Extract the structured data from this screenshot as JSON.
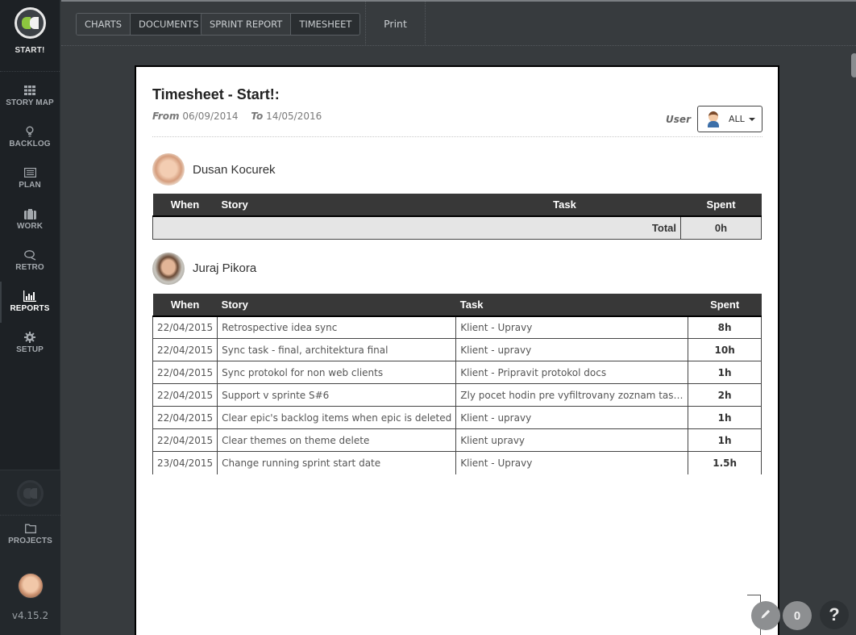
{
  "sidebar": {
    "brand": "START!",
    "items": [
      {
        "label": "STORY MAP",
        "icon": "grid-icon",
        "active": false
      },
      {
        "label": "BACKLOG",
        "icon": "lightbulb-icon",
        "active": false
      },
      {
        "label": "PLAN",
        "icon": "list-icon",
        "active": false
      },
      {
        "label": "WORK",
        "icon": "briefcase-icon",
        "active": false
      },
      {
        "label": "RETRO",
        "icon": "chat-icon",
        "active": false
      },
      {
        "label": "REPORTS",
        "icon": "bar-chart-icon",
        "active": true
      },
      {
        "label": "SETUP",
        "icon": "gear-icon",
        "active": false
      }
    ],
    "projects_label": "PROJECTS",
    "version": "v4.15.2"
  },
  "toolbar": {
    "group1": [
      {
        "label": "CHARTS",
        "active": false
      },
      {
        "label": "DOCUMENTS",
        "active": true
      }
    ],
    "group2": [
      {
        "label": "SPRINT REPORT",
        "active": false
      },
      {
        "label": "TIMESHEET",
        "active": true
      }
    ],
    "print_label": "Print"
  },
  "report": {
    "title": "Timesheet - Start!:",
    "from_label": "From",
    "from_date": "06/09/2014",
    "to_label": "To",
    "to_date": "14/05/2016",
    "user_label": "User",
    "user_value": "ALL"
  },
  "columns": {
    "when": "When",
    "story": "Story",
    "task": "Task",
    "spent": "Spent"
  },
  "people": [
    {
      "name": "Dusan Kocurek",
      "total_label": "Total",
      "total": "0h",
      "rows": []
    },
    {
      "name": "Juraj Pikora",
      "rows": [
        {
          "when": "22/04/2015",
          "story": "Retrospective idea sync",
          "task": "Klient - Upravy",
          "spent": "8h"
        },
        {
          "when": "22/04/2015",
          "story": "Sync task - final, architektura final",
          "task": "Klient - upravy",
          "spent": "10h"
        },
        {
          "when": "22/04/2015",
          "story": "Sync protokol for non web clients",
          "task": "Klient - Pripravit protokol docs",
          "spent": "1h"
        },
        {
          "when": "22/04/2015",
          "story": "Support v sprinte S#6",
          "task": "Zly pocet hodin pre vyfiltrovany zoznam taskov ...",
          "spent": "2h"
        },
        {
          "when": "22/04/2015",
          "story": "Clear epic's backlog items when epic is deleted",
          "task": "Klient - upravy",
          "spent": "1h"
        },
        {
          "when": "22/04/2015",
          "story": "Clear themes on theme delete",
          "task": "Klient upravy",
          "spent": "1h"
        },
        {
          "when": "23/04/2015",
          "story": "Change running sprint start date",
          "task": "Klient - Upravy",
          "spent": "1.5h"
        }
      ]
    }
  ],
  "floating": {
    "comment_count": "0",
    "help": "?"
  },
  "colors": {
    "accent_green": "#8cc63f",
    "sidebar_bg": "#1d2125",
    "table_header_bg": "#383838",
    "total_row_bg": "#e5e5e5"
  }
}
